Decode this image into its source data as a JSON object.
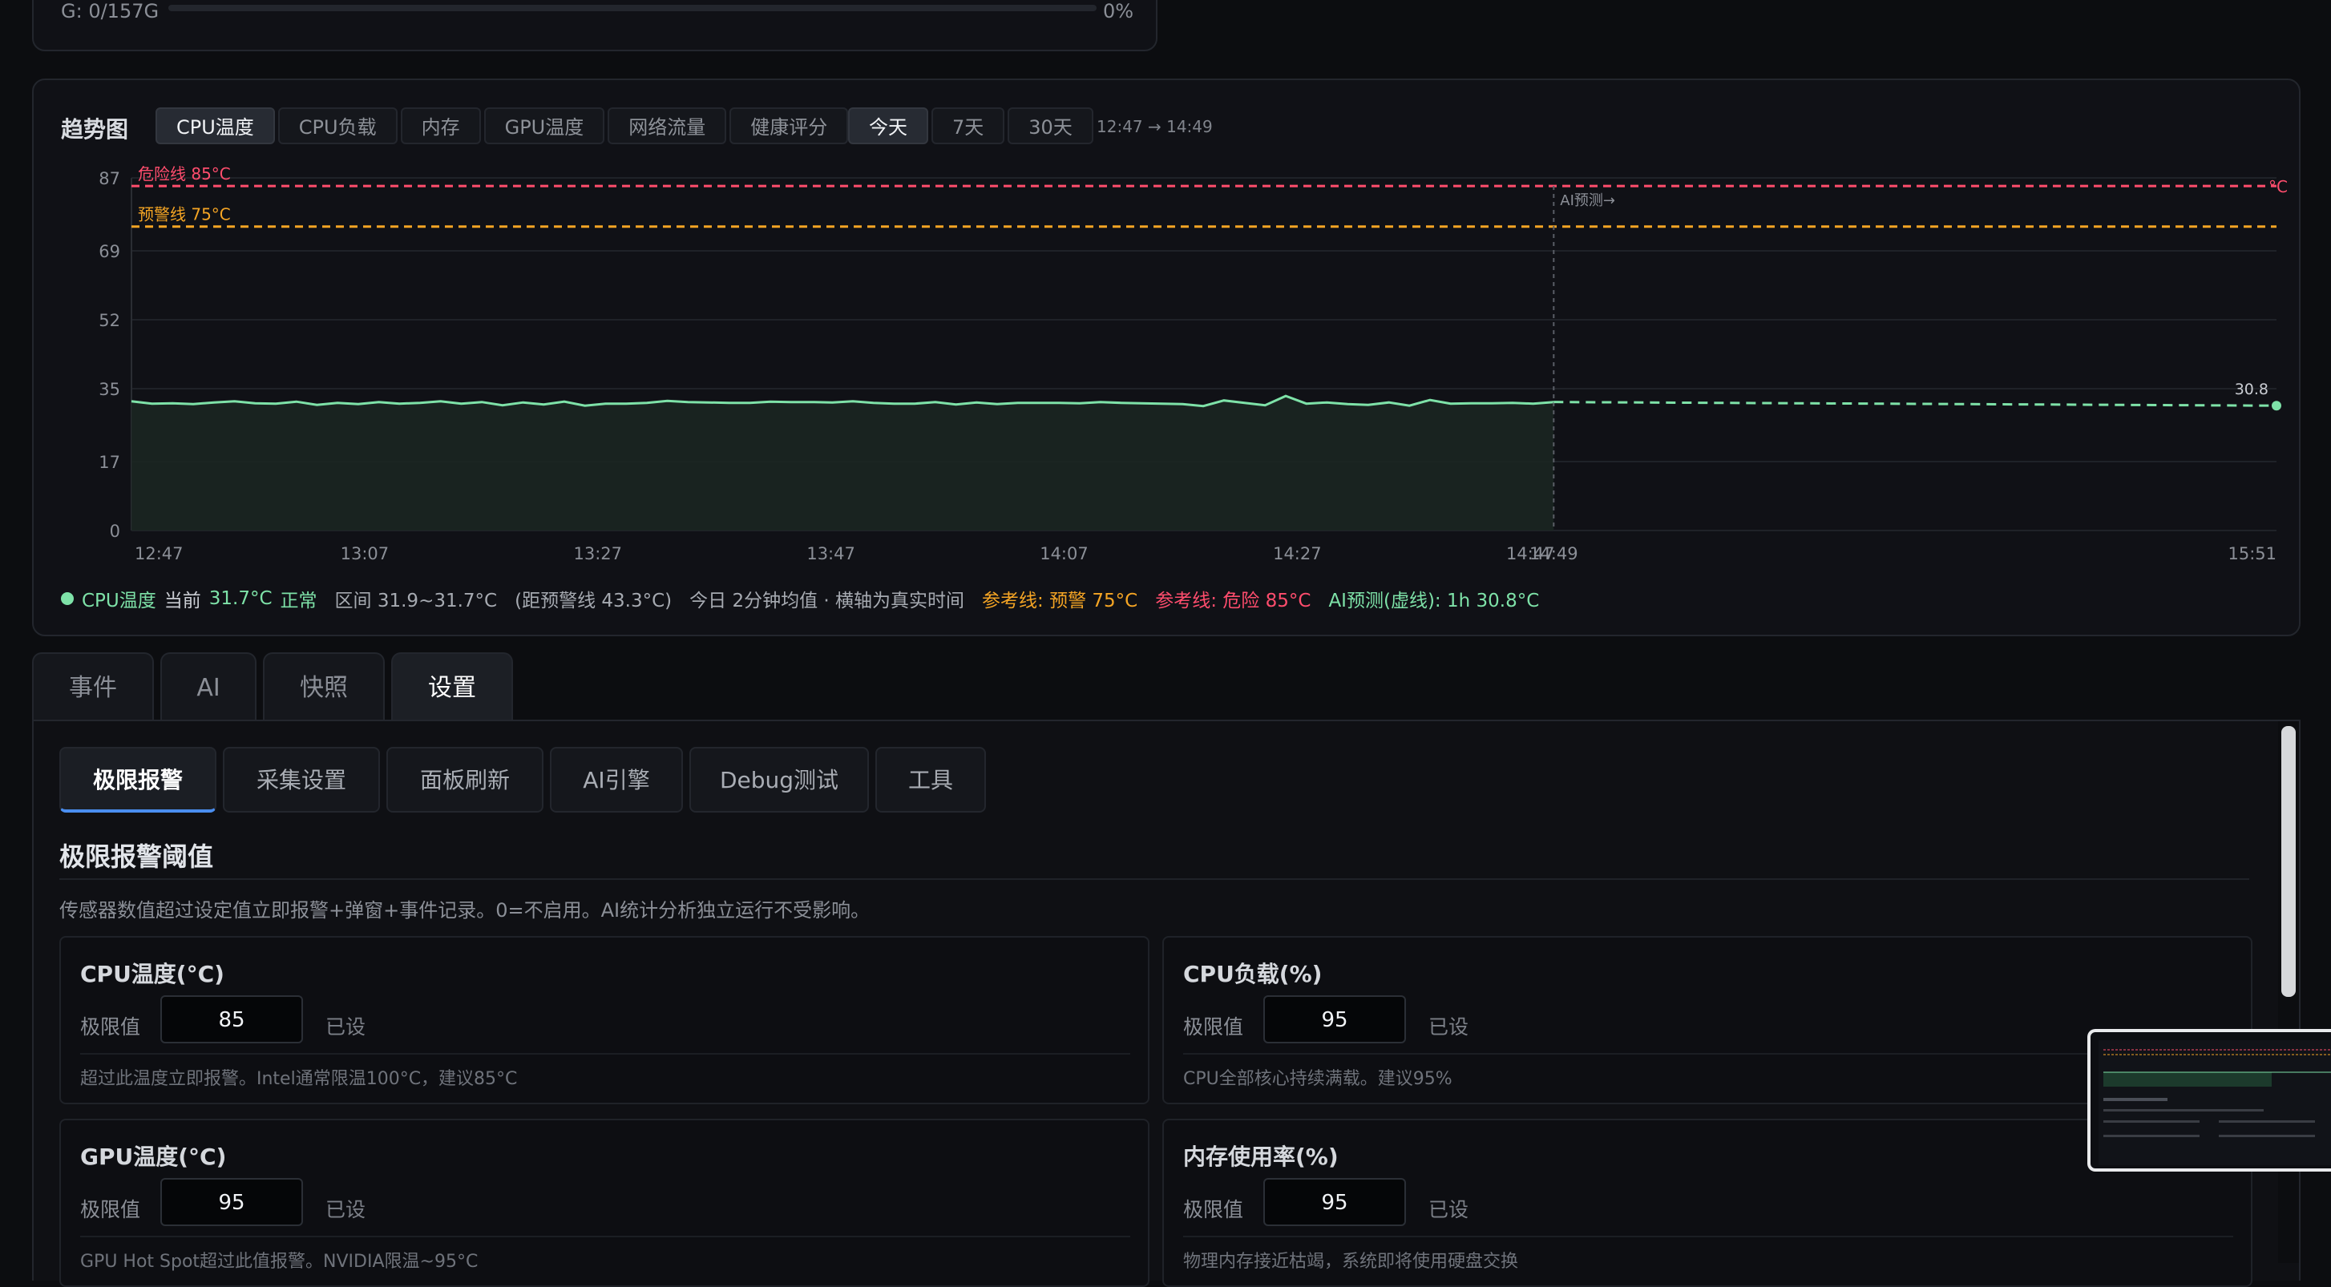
{
  "disk": {
    "label": "G: 0/157G",
    "percent": "0%",
    "fill": 0
  },
  "trend": {
    "title": "趋势图",
    "metric_tabs": [
      "CPU温度",
      "CPU负载",
      "内存",
      "GPU温度",
      "网络流量",
      "健康评分"
    ],
    "active_metric": 0,
    "range_tabs": [
      "今天",
      "7天",
      "30天"
    ],
    "active_range": 0,
    "range_text": "12:47 → 14:49",
    "legend": {
      "series": "CPU温度",
      "current_label": "当前",
      "current_value": "31.7°C",
      "status": "正常",
      "interval": "区间 31.9~31.7°C",
      "distance": "(距预警线 43.3°C)",
      "note": "今日 2分钟均值 · 横轴为真实时间",
      "ref_warn": "参考线: 预警 75°C",
      "ref_danger": "参考线: 危险 85°C",
      "ai": "AI预测(虚线): 1h 30.8°C"
    }
  },
  "chart_data": {
    "type": "line",
    "ylim": [
      0,
      87
    ],
    "yticks": [
      "87",
      "69",
      "52",
      "35",
      "17",
      "0"
    ],
    "ytick_values": [
      87,
      69,
      52,
      35,
      17,
      0
    ],
    "xticks": [
      "12:47",
      "13:07",
      "13:27",
      "13:47",
      "14:07",
      "14:27",
      "14:47",
      "14:49",
      "15:51"
    ],
    "xtick_minutes": [
      "12:47",
      "13:07",
      "13:27",
      "13:47",
      "14:07",
      "14:27",
      "14:47",
      "14:49",
      "15:51"
    ],
    "danger_line": {
      "label": "危险线 85°C",
      "value": 85
    },
    "warn_line": {
      "label": "预警线 75°C",
      "value": 75
    },
    "ai_marker_label": "AI预测→",
    "right_unit": "°C",
    "forecast_end_label": "30.8",
    "series": [
      {
        "name": "CPU温度",
        "x_start": "12:47",
        "x_end": "14:49",
        "values": [
          31.9,
          31.3,
          31.4,
          31.2,
          31.6,
          31.9,
          31.4,
          31.3,
          31.8,
          31.0,
          31.5,
          31.2,
          31.7,
          31.3,
          31.5,
          31.9,
          31.3,
          31.7,
          30.9,
          31.6,
          31.1,
          31.8,
          30.8,
          31.3,
          31.3,
          31.5,
          32.0,
          31.7,
          31.6,
          31.5,
          31.5,
          31.8,
          31.7,
          31.7,
          31.6,
          31.9,
          31.5,
          31.3,
          31.3,
          31.7,
          31.1,
          31.6,
          31.2,
          31.5,
          31.5,
          31.5,
          31.4,
          31.7,
          31.5,
          31.4,
          31.3,
          31.2,
          30.7,
          32.1,
          31.5,
          30.9,
          33.2,
          31.3,
          31.6,
          31.2,
          31.0,
          31.6,
          30.8,
          32.2,
          31.3,
          31.4,
          31.4,
          31.5,
          31.3,
          31.7
        ]
      },
      {
        "name": "AI预测",
        "x_start": "14:49",
        "x_end": "15:51",
        "values": [
          31.7,
          30.8
        ]
      }
    ]
  },
  "bottom_tabs": [
    "事件",
    "AI",
    "快照",
    "设置"
  ],
  "active_bottom_tab": 3,
  "settings": {
    "sub_tabs": [
      "极限报警",
      "采集设置",
      "面板刷新",
      "AI引擎",
      "Debug测试",
      "工具"
    ],
    "active_sub_tab": 0,
    "section_title": "极限报警阈值",
    "section_desc": "传感器数值超过设定值立即报警+弹窗+事件记录。0=不启用。AI统计分析独立运行不受影响。",
    "limit_label": "极限值",
    "set_label": "已设",
    "cards": [
      {
        "title": "CPU温度(°C)",
        "value": "85",
        "hint": "超过此温度立即报警。Intel通常限温100°C，建议85°C"
      },
      {
        "title": "CPU负载(%)",
        "value": "95",
        "hint": "CPU全部核心持续满载。建议95%"
      },
      {
        "title": "GPU温度(°C)",
        "value": "95",
        "hint": "GPU Hot Spot超过此值报警。NVIDIA限温~95°C"
      },
      {
        "title": "内存使用率(%)",
        "value": "95",
        "hint": "物理内存接近枯竭，系统即将使用硬盘交换"
      }
    ]
  },
  "colors": {
    "danger": "#ff4d6d",
    "warn": "#f5a524",
    "series": "#7ee2a8",
    "accent": "#4a8ef0"
  }
}
